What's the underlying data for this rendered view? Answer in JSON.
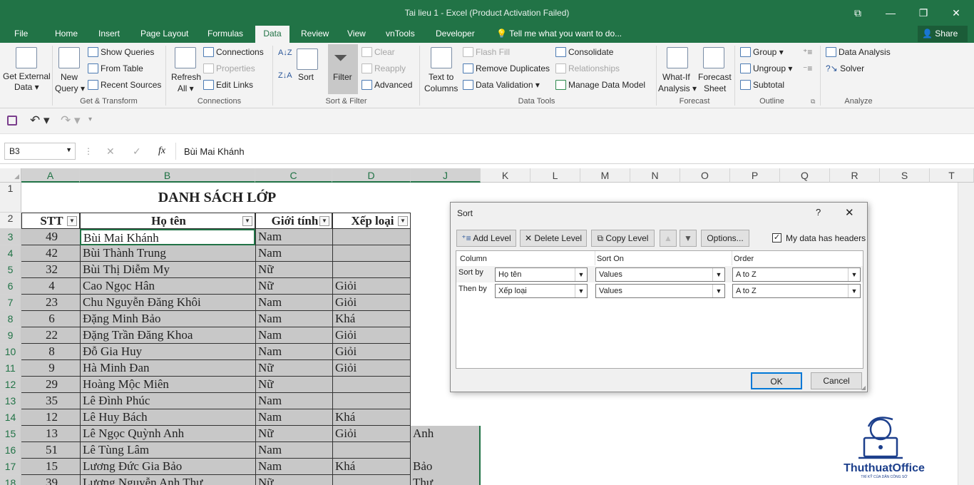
{
  "window": {
    "title": "Tai lieu 1 - Excel (Product Activation Failed)",
    "min": "—",
    "restore": "❐",
    "close": "✕",
    "ribbon_opt": "⧉"
  },
  "tabs": [
    "File",
    "Home",
    "Insert",
    "Page Layout",
    "Formulas",
    "Data",
    "Review",
    "View",
    "vnTools",
    "Developer"
  ],
  "tell_me": "Tell me what you want to do...",
  "share": "Share",
  "ribbon": {
    "get_external": "Get External",
    "data": "Data ▾",
    "new": "New",
    "query": "Query ▾",
    "show_queries": "Show Queries",
    "from_table": "From Table",
    "recent_sources": "Recent Sources",
    "g_transform": "Get & Transform",
    "connections": "Connections",
    "properties": "Properties",
    "edit_links": "Edit Links",
    "refresh": "Refresh",
    "all": "All ▾",
    "g_connections": "Connections",
    "sort": "Sort",
    "filter": "Filter",
    "clear": "Clear",
    "reapply": "Reapply",
    "advanced": "Advanced",
    "g_sortfilter": "Sort & Filter",
    "text_to": "Text to",
    "columns": "Columns",
    "flash_fill": "Flash Fill",
    "remove_dup": "Remove Duplicates",
    "data_validation": "Data Validation",
    "consolidate": "Consolidate",
    "relationships": "Relationships",
    "manage_model": "Manage Data Model",
    "g_datatools": "Data Tools",
    "whatif": "What-If",
    "analysis": "Analysis ▾",
    "forecast_sheet": "Forecast",
    "sheet": "Sheet",
    "g_forecast": "Forecast",
    "group": "Group",
    "ungroup": "Ungroup",
    "subtotal": "Subtotal",
    "g_outline": "Outline",
    "data_analysis": "Data Analysis",
    "solver": "Solver",
    "g_analyze": "Analyze"
  },
  "formula": {
    "namebox": "B3",
    "fx": "fx",
    "value": "Bùi Mai Khánh",
    "cancel": "✕",
    "enter": "✓"
  },
  "columns": [
    "A",
    "B",
    "C",
    "D",
    "J",
    "K",
    "L",
    "M",
    "N",
    "O",
    "P",
    "Q",
    "R",
    "S",
    "T"
  ],
  "sheet": {
    "title": "DANH SÁCH LỚP",
    "headers": [
      "STT",
      "Họ tên",
      "Giới tính",
      "Xếp loại"
    ],
    "rows": [
      [
        "3",
        "49",
        "Bùi Mai Khánh",
        "Nam",
        ""
      ],
      [
        "4",
        "42",
        "Bùi Thành Trung",
        "Nam",
        ""
      ],
      [
        "5",
        "32",
        "Bùi Thị Diễm My",
        "Nữ",
        ""
      ],
      [
        "6",
        "4",
        "Cao Ngọc Hân",
        "Nữ",
        "Giỏi"
      ],
      [
        "7",
        "23",
        "Chu Nguyễn Đăng Khôi",
        "Nam",
        "Giỏi"
      ],
      [
        "8",
        "6",
        "Đặng Minh Bảo",
        "Nam",
        "Khá"
      ],
      [
        "9",
        "22",
        "Đặng Trần Đăng Khoa",
        "Nam",
        "Giỏi"
      ],
      [
        "10",
        "8",
        "Đỗ Gia Huy",
        "Nam",
        "Giỏi"
      ],
      [
        "11",
        "9",
        "Hà Minh Đan",
        "Nữ",
        "Giỏi"
      ],
      [
        "12",
        "29",
        "Hoàng Mộc Miên",
        "Nữ",
        ""
      ],
      [
        "13",
        "35",
        "Lê Đình Phúc",
        "Nam",
        ""
      ],
      [
        "14",
        "12",
        "Lê Huy Bách",
        "Nam",
        "Khá"
      ],
      [
        "15",
        "13",
        "Lê Ngọc Quỳnh Anh",
        "Nữ",
        "Giỏi"
      ],
      [
        "16",
        "51",
        "Lê Tùng Lâm",
        "Nam",
        ""
      ],
      [
        "17",
        "15",
        "Lương Đức Gia Bảo",
        "Nam",
        "Khá"
      ],
      [
        "18",
        "39",
        "Lương Nguyễn Anh Thư",
        "Nữ",
        ""
      ]
    ],
    "jcol": {
      "15": "Anh",
      "17": "Bảo",
      "18": "Thư"
    }
  },
  "dialog": {
    "title": "Sort",
    "help": "?",
    "close": "✕",
    "add_level": "Add Level",
    "delete_level": "Delete Level",
    "copy_level": "Copy Level",
    "up": "▲",
    "down": "▼",
    "options": "Options...",
    "headers_label": "My data has headers",
    "headers_checked": true,
    "col_column": "Column",
    "col_sorton": "Sort On",
    "col_order": "Order",
    "levels": [
      {
        "label": "Sort by",
        "column": "Họ tên",
        "sorton": "Values",
        "order": "A to Z"
      },
      {
        "label": "Then by",
        "column": "Xếp loại",
        "sorton": "Values",
        "order": "A to Z"
      }
    ],
    "ok": "OK",
    "cancel": "Cancel"
  },
  "brand": {
    "name": "ThuthuatOffice",
    "tagline": "TRÍ KỸ CỦA DÂN CÔNG SỞ"
  }
}
